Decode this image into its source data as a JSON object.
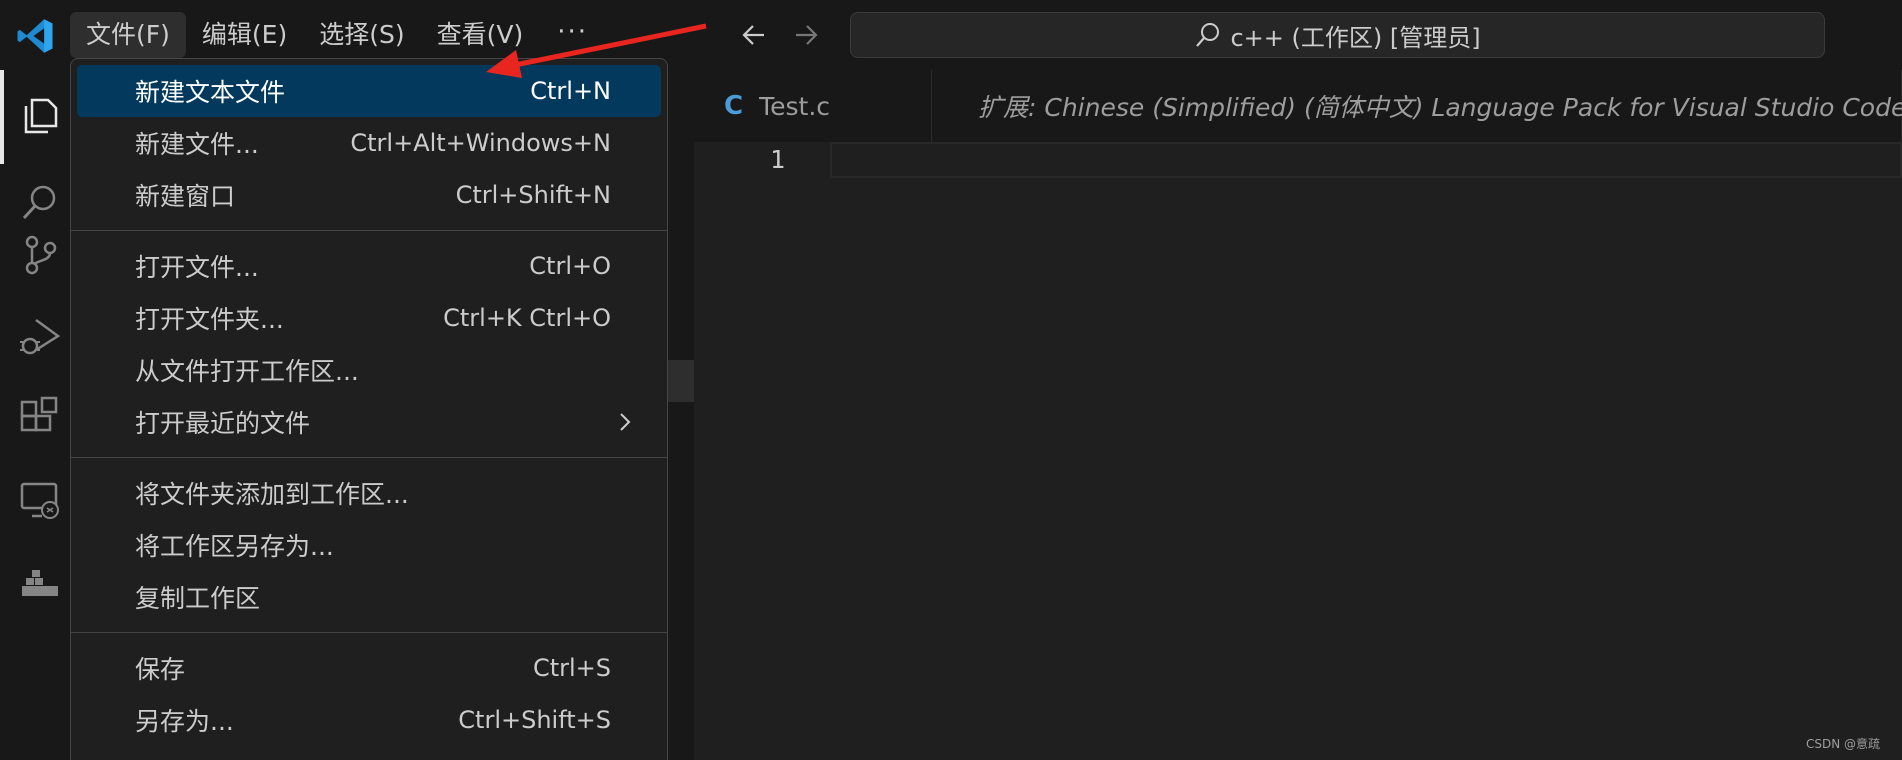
{
  "menubar": {
    "items": [
      {
        "label": "文件(F)"
      },
      {
        "label": "编辑(E)"
      },
      {
        "label": "选择(S)"
      },
      {
        "label": "查看(V)"
      }
    ],
    "more_label": "···"
  },
  "command_center": {
    "text": "c++ (工作区) [管理员]"
  },
  "tabs": [
    {
      "icon": "c-file-icon",
      "glyph": "C",
      "label": "Test.c"
    },
    {
      "icon": "extensions-icon",
      "label": "扩展: Chinese (Simplified) (简体中文) Language Pack for Visual Studio Code"
    }
  ],
  "editor": {
    "line_numbers": [
      "1"
    ]
  },
  "file_menu": {
    "groups": [
      [
        {
          "label": "新建文本文件",
          "shortcut": "Ctrl+N",
          "highlighted": true
        },
        {
          "label": "新建文件...",
          "shortcut": "Ctrl+Alt+Windows+N"
        },
        {
          "label": "新建窗口",
          "shortcut": "Ctrl+Shift+N"
        }
      ],
      [
        {
          "label": "打开文件...",
          "shortcut": "Ctrl+O"
        },
        {
          "label": "打开文件夹...",
          "shortcut": "Ctrl+K Ctrl+O"
        },
        {
          "label": "从文件打开工作区...",
          "shortcut": ""
        },
        {
          "label": "打开最近的文件",
          "shortcut": "",
          "submenu": true
        }
      ],
      [
        {
          "label": "将文件夹添加到工作区...",
          "shortcut": ""
        },
        {
          "label": "将工作区另存为...",
          "shortcut": ""
        },
        {
          "label": "复制工作区",
          "shortcut": ""
        }
      ],
      [
        {
          "label": "保存",
          "shortcut": "Ctrl+S"
        },
        {
          "label": "另存为...",
          "shortcut": "Ctrl+Shift+S"
        }
      ]
    ]
  },
  "activitybar": {
    "icons": [
      "explorer-icon",
      "search-icon",
      "source-control-icon",
      "run-debug-icon",
      "extensions-icon",
      "remote-explorer-icon",
      "docker-icon"
    ]
  },
  "watermark": "CSDN @意疏",
  "colors": {
    "highlight": "#04395e",
    "accent_blue": "#4a9bd6",
    "annotation_red": "#e8261f"
  }
}
